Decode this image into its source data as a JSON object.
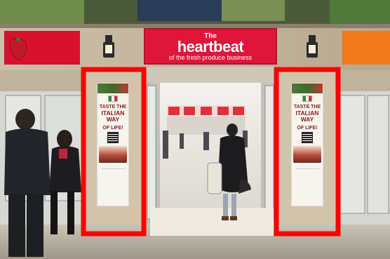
{
  "scene": {
    "banner": {
      "line1": "The",
      "line2": "heartbeat",
      "line3": "of the fresh produce business"
    },
    "poster": {
      "line1": "TASTE THE",
      "line2": "ITALIAN",
      "line3": "WAY",
      "line4": "OF LIFE!"
    },
    "colors": {
      "highlight_frame": "#ff0000",
      "banner_red": "#e0153a",
      "banner_orange": "#f07a1a"
    }
  }
}
